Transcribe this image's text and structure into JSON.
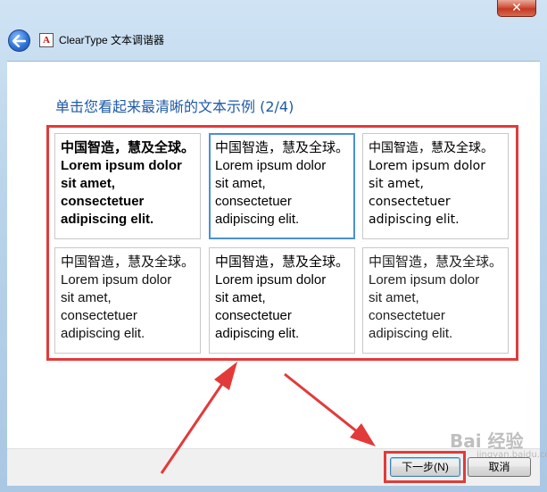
{
  "window": {
    "title": "ClearType 文本调谐器",
    "close_glyph": "✕"
  },
  "instruction": "单击您看起来最清晰的文本示例 (2/4)",
  "samples": [
    {
      "lines": [
        "中国智造，慧及全球。",
        "Lorem ipsum dolor",
        "sit amet,",
        "consectetuer",
        "adipiscing elit."
      ],
      "selected": false
    },
    {
      "lines": [
        "中国智造，慧及全球。",
        "Lorem ipsum dolor",
        "sit amet,",
        "consectetuer",
        "adipiscing elit."
      ],
      "selected": true
    },
    {
      "lines": [
        "中国智造，慧及全球。",
        "Lorem ipsum dolor",
        "sit amet,",
        "consectetuer",
        "adipiscing elit."
      ],
      "selected": false
    },
    {
      "lines": [
        "中国智造，慧及全球。",
        "Lorem ipsum dolor",
        "sit amet,",
        "consectetuer",
        "adipiscing elit."
      ],
      "selected": false
    },
    {
      "lines": [
        "中国智造，慧及全球。",
        "Lorem ipsum dolor",
        "sit amet,",
        "consectetuer",
        "adipiscing elit."
      ],
      "selected": false
    },
    {
      "lines": [
        "中国智造，慧及全球。",
        "Lorem ipsum dolor",
        "sit amet,",
        "consectetuer",
        "adipiscing elit."
      ],
      "selected": false
    }
  ],
  "buttons": {
    "next_label": "下一步(N)",
    "cancel_label": "取消"
  },
  "watermark": {
    "brand": "Bai 经验",
    "sub": "jingyan.baidu.com"
  },
  "colors": {
    "highlight_red": "#e23a3a",
    "selection_blue": "#4a90d6",
    "instruction_blue": "#1e5aa8"
  }
}
